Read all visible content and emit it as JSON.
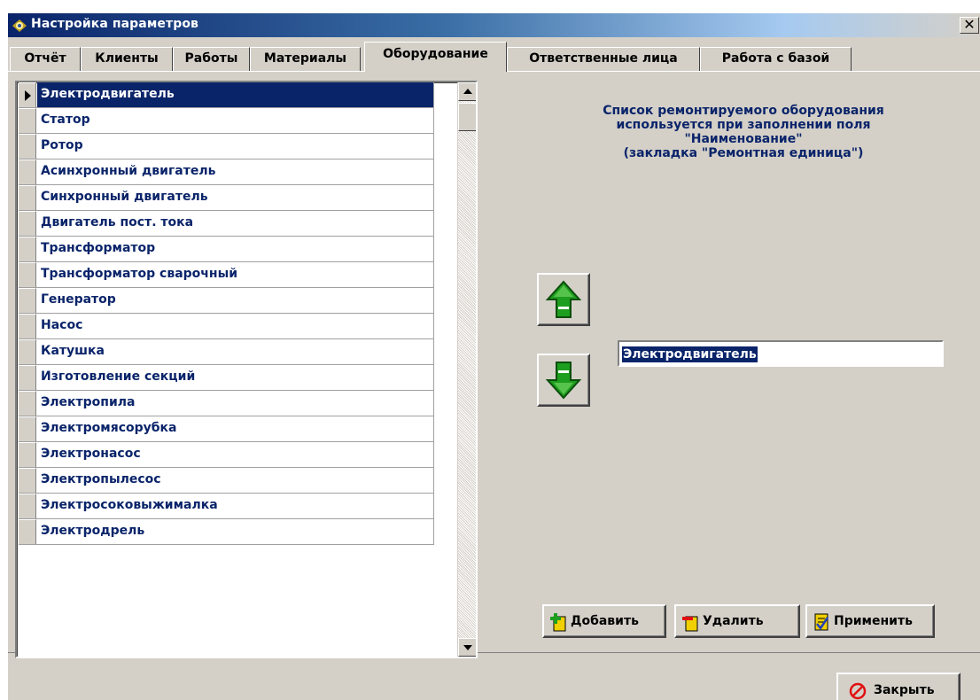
{
  "window": {
    "title": "Настройка параметров",
    "close_glyph": "✕"
  },
  "tabs": [
    {
      "label": "Отчёт"
    },
    {
      "label": "Клиенты"
    },
    {
      "label": "Работы"
    },
    {
      "label": "Материалы"
    },
    {
      "label": "Оборудование",
      "active": true
    },
    {
      "label": "Ответственные лица"
    },
    {
      "label": "Работа с базой"
    }
  ],
  "equipment_list": {
    "selected_index": 0,
    "items": [
      "Электродвигатель",
      "Статор",
      "Ротор",
      "Асинхронный двигатель",
      "Синхронный двигатель",
      "Двигатель пост. тока",
      "Трансформатор",
      "Трансформатор сварочный",
      "Генератор",
      "Насос",
      "Катушка",
      "Изготовление секций",
      "Электропила",
      "Электромясорубка",
      "Электронасос",
      "Электропылесос",
      "Электросоковыжималка",
      "Электродрель"
    ]
  },
  "info": {
    "line1": "Список ремонтируемого оборудования",
    "line2": "используется при заполнении поля",
    "line3": "\"Наименование\"",
    "line4": "(закладка \"Ремонтная единица\")"
  },
  "edit": {
    "value": "Электродвигатель"
  },
  "buttons": {
    "add": "Добавить",
    "delete": "Удалить",
    "apply": "Применить",
    "close": "Закрыть"
  },
  "icons": {
    "title": "app-icon",
    "move_up": "arrow-up-icon",
    "move_down": "arrow-down-icon",
    "add": "add-document-icon",
    "delete": "delete-document-icon",
    "apply": "apply-checklist-icon",
    "close": "no-entry-icon"
  },
  "colors": {
    "title_start": "#0a246a",
    "face": "#d4d0c8",
    "text_blue": "#0a246a",
    "selection": "#0a246a",
    "green": "#1e9e1e",
    "close_red": "#e01010"
  }
}
